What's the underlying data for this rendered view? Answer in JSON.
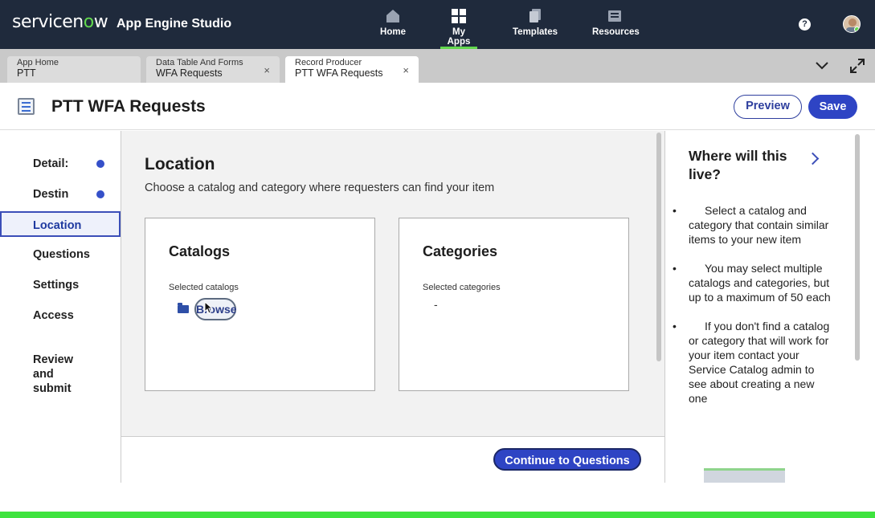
{
  "topnav": {
    "logo_text_a": "servicen",
    "logo_text_b": "w",
    "app_name": "App Engine Studio",
    "items": [
      {
        "label": "Home",
        "icon": "home-icon"
      },
      {
        "label": "My Apps",
        "icon": "grid-icon"
      },
      {
        "label": "Templates",
        "icon": "templates-icon"
      },
      {
        "label": "Resources",
        "icon": "resources-icon"
      }
    ],
    "help": "?"
  },
  "tabs": [
    {
      "title": "App Home",
      "subtitle": "PTT"
    },
    {
      "title": "Data Table And Forms",
      "subtitle": "WFA Requests",
      "close": "×"
    },
    {
      "title": "Record Producer",
      "subtitle": "PTT WFA Requests",
      "close": "×"
    }
  ],
  "header": {
    "title": "PTT WFA Requests",
    "preview_label": "Preview",
    "save_label": "Save"
  },
  "leftnav": {
    "items": [
      {
        "label": "Detail:"
      },
      {
        "label": "Destin"
      },
      {
        "label": "Location"
      },
      {
        "label": "Questions"
      },
      {
        "label": "Settings"
      },
      {
        "label": "Access"
      },
      {
        "label": "Review\nand\nsubmit"
      }
    ]
  },
  "main": {
    "title": "Location",
    "subtitle": "Choose a catalog and category where requesters can find your item",
    "catalogs": {
      "title": "Catalogs",
      "label": "Selected catalogs",
      "browse_label": "Browse"
    },
    "categories": {
      "title": "Categories",
      "label": "Selected categories",
      "value": "-"
    },
    "continue_label": "Continue to Questions"
  },
  "rpanel": {
    "title": "Where will this live?",
    "bullets": [
      "Select a catalog and category that contain similar items to your new item",
      "You may select multiple catalogs and categories, but up to a maximum of 50 each",
      "If you don't find a catalog or category that will work for your item contact your Service Catalog admin to see about creating a new one"
    ]
  },
  "colors": {
    "nav_bg": "#1f2a3c",
    "accent": "#2e44c4",
    "brand_green": "#62d84e"
  }
}
